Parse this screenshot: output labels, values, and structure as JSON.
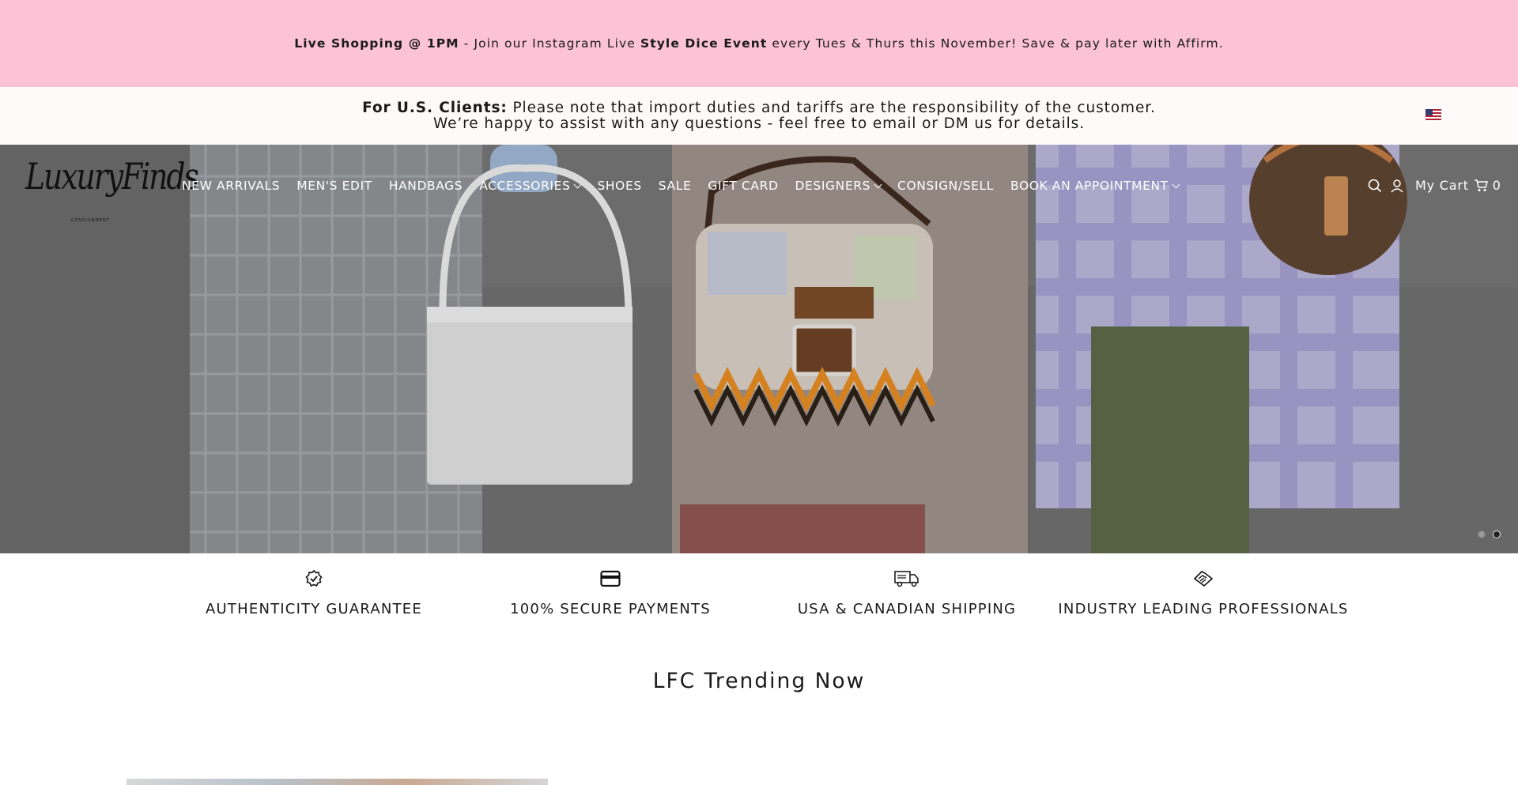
{
  "promo": {
    "part1_bold": "Live Shopping @ 1PM",
    "part2": " - Join our Instagram Live ",
    "part3_bold": "Style Dice Event",
    "part4": " every Tues & Thurs this November! Save & pay later with Affirm."
  },
  "notice": {
    "label_bold": "For U.S. Clients:",
    "line1": " Please note that import duties and tariffs are the responsibility of the customer.",
    "line2": "We’re happy to assist with any questions - feel free to email or DM us for details."
  },
  "country_flag_icon": "us-flag-icon",
  "logo": {
    "text": "LuxuryFinds",
    "subtext": "CONSIGNMENT"
  },
  "nav": {
    "items": [
      {
        "label": "NEW ARRIVALS",
        "dropdown": false
      },
      {
        "label": "MEN'S EDIT",
        "dropdown": false
      },
      {
        "label": "HANDBAGS",
        "dropdown": false
      },
      {
        "label": "ACCESSORIES",
        "dropdown": true
      },
      {
        "label": "SHOES",
        "dropdown": false
      },
      {
        "label": "SALE",
        "dropdown": false
      },
      {
        "label": "GIFT CARD",
        "dropdown": false
      },
      {
        "label": "DESIGNERS",
        "dropdown": true
      },
      {
        "label": "CONSIGN/SELL",
        "dropdown": false
      },
      {
        "label": "BOOK AN APPOINTMENT",
        "dropdown": true
      }
    ]
  },
  "tools": {
    "search_icon": "search-icon",
    "account_icon": "user-icon",
    "cart_label": "My Cart",
    "cart_icon": "cart-icon",
    "cart_count": "0"
  },
  "hero": {
    "slides_total": 2,
    "active_slide": 2
  },
  "features": [
    {
      "icon": "badge-check-icon",
      "label": "AUTHENTICITY GUARANTEE"
    },
    {
      "icon": "credit-card-icon",
      "label": "100% SECURE PAYMENTS"
    },
    {
      "icon": "truck-icon",
      "label": "USA & CANADIAN SHIPPING"
    },
    {
      "icon": "handshake-icon",
      "label": "INDUSTRY LEADING PROFESSIONALS"
    }
  ],
  "section": {
    "title": "LFC Trending Now"
  },
  "colors": {
    "promo_bg": "#fcc2d6",
    "notice_bg": "#fffafa",
    "nav_text": "#ffffff",
    "text": "#1a1a1a"
  }
}
